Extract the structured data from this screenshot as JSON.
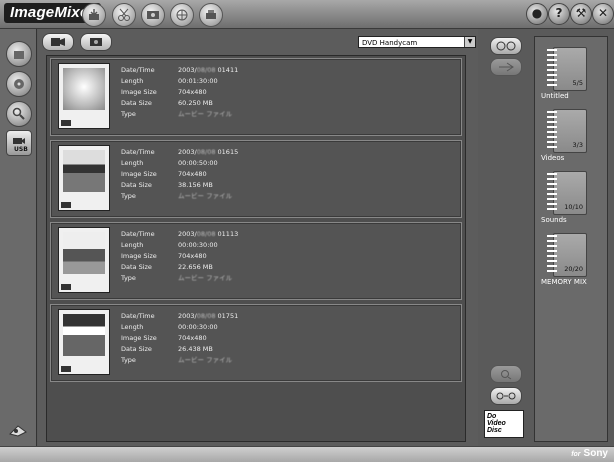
{
  "app": {
    "title": "ImageMixer",
    "brand_for": "for",
    "brand_name": "Sony"
  },
  "device_select": {
    "selected": "DVD Handycam"
  },
  "detail_labels": {
    "datetime": "Date/Time",
    "length": "Length",
    "image_size": "Image Size",
    "data_size": "Data Size",
    "type": "Type"
  },
  "items": [
    {
      "datetime": "2003/",
      "datetime_blur": "08/08",
      "datetime_tail": " 01411",
      "length": "00:01:30:00",
      "image_size": "704x480",
      "data_size": "60.250 MB",
      "type": "ムービー ファイル"
    },
    {
      "datetime": "2003/",
      "datetime_blur": "08/08",
      "datetime_tail": " 01615",
      "length": "00:00:50:00",
      "image_size": "704x480",
      "data_size": "38.156 MB",
      "type": "ムービー ファイル"
    },
    {
      "datetime": "2003/",
      "datetime_blur": "08/08",
      "datetime_tail": " 01113",
      "length": "00:00:30:00",
      "image_size": "704x480",
      "data_size": "22.656 MB",
      "type": "ムービー ファイル"
    },
    {
      "datetime": "2003/",
      "datetime_blur": "08/08",
      "datetime_tail": " 01751",
      "length": "00:00:30:00",
      "image_size": "704x480",
      "data_size": "26.438 MB",
      "type": "ムービー ファイル"
    }
  ],
  "albums": [
    {
      "label": "Untitled",
      "count": "5/5"
    },
    {
      "label": "Videos",
      "count": "3/3"
    },
    {
      "label": "Sounds",
      "count": "10/10"
    },
    {
      "label": "MEMORY MIX",
      "count": "20/20"
    }
  ],
  "dvd_logo": {
    "line1": "Do",
    "line2": "Video",
    "line3": "Disc"
  }
}
